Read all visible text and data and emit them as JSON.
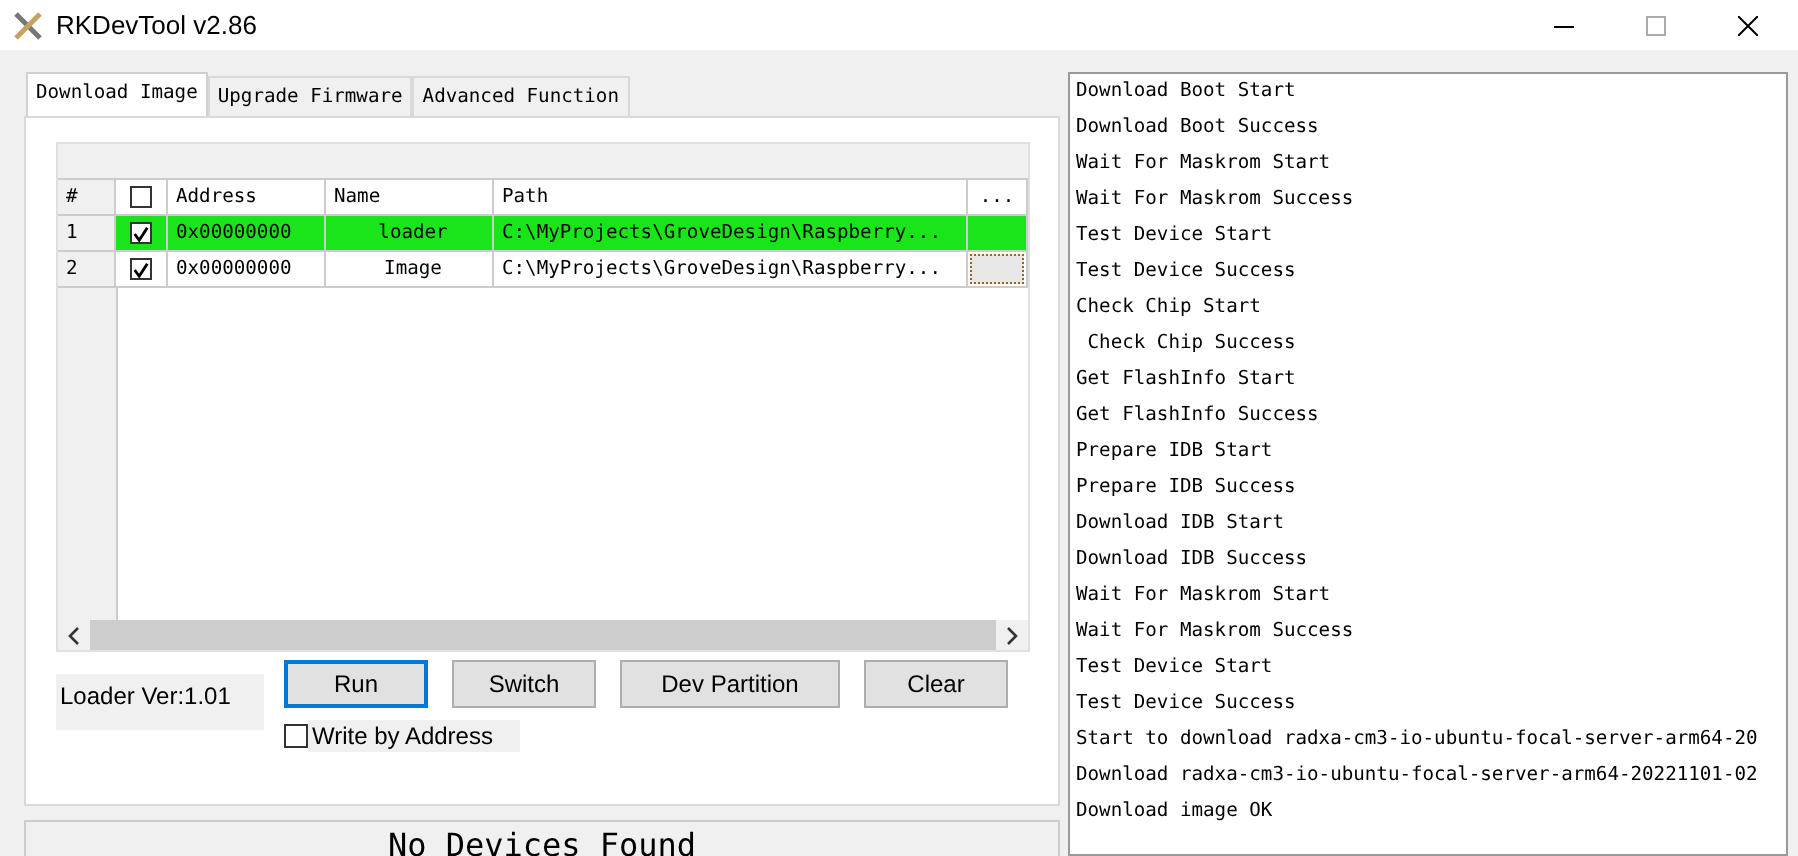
{
  "window": {
    "title": "RKDevTool v2.86"
  },
  "tabs": [
    {
      "label": "Download Image",
      "selected": true
    },
    {
      "label": "Upgrade Firmware",
      "selected": false
    },
    {
      "label": "Advanced Function",
      "selected": false
    }
  ],
  "table": {
    "header_checked": false,
    "columns": [
      "#",
      "Address",
      "Name",
      "Path",
      "..."
    ],
    "rows": [
      {
        "index": "1",
        "checked": true,
        "selected": true,
        "address": "0x00000000",
        "name": "loader",
        "path": "C:\\MyProjects\\GroveDesign\\Raspberry..."
      },
      {
        "index": "2",
        "checked": true,
        "selected": false,
        "address": "0x00000000",
        "name": "Image",
        "path": "C:\\MyProjects\\GroveDesign\\Raspberry..."
      }
    ]
  },
  "loader_version": "Loader Ver:1.01",
  "buttons": [
    {
      "label": "Run",
      "focused": true
    },
    {
      "label": "Switch",
      "focused": false
    },
    {
      "label": "Dev Partition",
      "focused": false
    },
    {
      "label": "Clear",
      "focused": false
    }
  ],
  "write_by_address": {
    "label": "Write by Address",
    "checked": false
  },
  "status": "No Devices Found",
  "log": [
    "Download Boot Start",
    "Download Boot Success",
    "Wait For Maskrom Start",
    "Wait For Maskrom Success",
    "Test Device Start",
    "Test Device Success",
    "Check Chip Start",
    " Check Chip Success",
    "Get FlashInfo Start",
    "Get FlashInfo Success",
    "Prepare IDB Start",
    "Prepare IDB Success",
    "Download IDB Start",
    "Download IDB Success",
    "Wait For Maskrom Start",
    "Wait For Maskrom Success",
    "Test Device Start",
    "Test Device Success",
    "Start to download radxa-cm3-io-ubuntu-focal-server-arm64-20",
    "Download radxa-cm3-io-ubuntu-focal-server-arm64-20221101-02",
    "Download image OK"
  ]
}
